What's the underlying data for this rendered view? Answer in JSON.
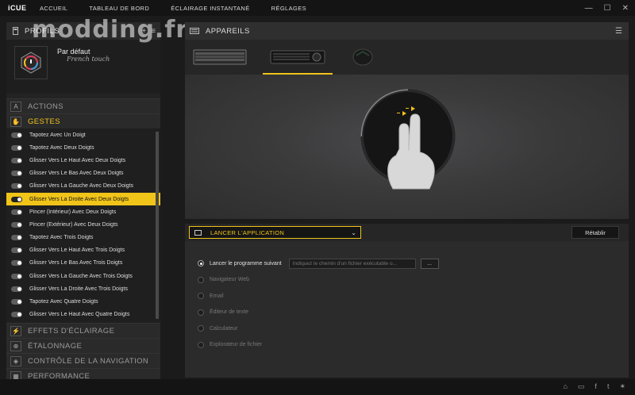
{
  "app": {
    "brand": "iCUE"
  },
  "nav": [
    {
      "label": "ACCUEIL"
    },
    {
      "label": "TABLEAU DE BORD"
    },
    {
      "label": "ÉCLAIRAGE INSTANTANÉ"
    },
    {
      "label": "RÉGLAGES"
    }
  ],
  "window_controls": {
    "min": "—",
    "max": "☐",
    "close": "✕"
  },
  "watermark": "modding.fr",
  "profiles": {
    "title": "PROFILS",
    "add": "+",
    "list": "≡",
    "current_name": "Par défaut",
    "current_subtitle": "French touch"
  },
  "sections": {
    "actions": {
      "label": "ACTIONS",
      "icon": "A"
    },
    "gestures": {
      "label": "GESTES",
      "icon": "✋"
    },
    "lighting": {
      "label": "EFFETS D'ÉCLAIRAGE",
      "icon": "⚡"
    },
    "calibration": {
      "label": "ÉTALONNAGE",
      "icon": "⊕"
    },
    "navigation": {
      "label": "CONTRÔLE DE LA NAVIGATION",
      "icon": "◈"
    },
    "performance": {
      "label": "PERFORMANCE",
      "icon": "▦"
    }
  },
  "gestures": [
    {
      "label": "Tapotez Avec Un Doigt",
      "selected": false
    },
    {
      "label": "Tapotez Avec Deux Doigts",
      "selected": false
    },
    {
      "label": "Glisser Vers Le Haut Avec Deux Doigts",
      "selected": false
    },
    {
      "label": "Glisser Vers Le Bas Avec Deux Doigts",
      "selected": false
    },
    {
      "label": "Glisser Vers La Gauche Avec Deux Doigts",
      "selected": false
    },
    {
      "label": "Glisser Vers La Droite Avec Deux Doigts",
      "selected": true
    },
    {
      "label": "Pincer (Intérieur) Avec Deux Doigts",
      "selected": false
    },
    {
      "label": "Pincer (Extérieur) Avec Deux Doigts",
      "selected": false
    },
    {
      "label": "Tapotez Avec Trois Doigts",
      "selected": false
    },
    {
      "label": "Glisser Vers Le Haut Avec Trois Doigts",
      "selected": false
    },
    {
      "label": "Glisser Vers Le Bas Avec Trois Doigts",
      "selected": false
    },
    {
      "label": "Glisser Vers La Gauche Avec Trois Doigts",
      "selected": false
    },
    {
      "label": "Glisser Vers La Droite Avec Trois Doigts",
      "selected": false
    },
    {
      "label": "Tapotez Avec Quatre Doigts",
      "selected": false
    },
    {
      "label": "Glisser Vers Le Haut Avec Quatre Doigts",
      "selected": false
    }
  ],
  "devices": {
    "title": "APPAREILS",
    "items": [
      {
        "name": "keyboard-k95",
        "active": false
      },
      {
        "name": "keyboard-k83",
        "active": true
      },
      {
        "name": "mouse",
        "active": false
      }
    ]
  },
  "action": {
    "selected": "LANCER L'APPLICATION",
    "reset": "Rétablir"
  },
  "options": [
    {
      "label": "Lancer le programme suivant",
      "checked": true
    },
    {
      "label": "Navigateur Web",
      "checked": false
    },
    {
      "label": "Email",
      "checked": false
    },
    {
      "label": "Éditeur de texte",
      "checked": false
    },
    {
      "label": "Calculateur",
      "checked": false
    },
    {
      "label": "Explorateur de fichier",
      "checked": false
    }
  ],
  "path_input": {
    "placeholder": "Indiquez le chemin d'un fichier exécutable o...",
    "browse": "..."
  },
  "colors": {
    "accent": "#f0c419"
  }
}
